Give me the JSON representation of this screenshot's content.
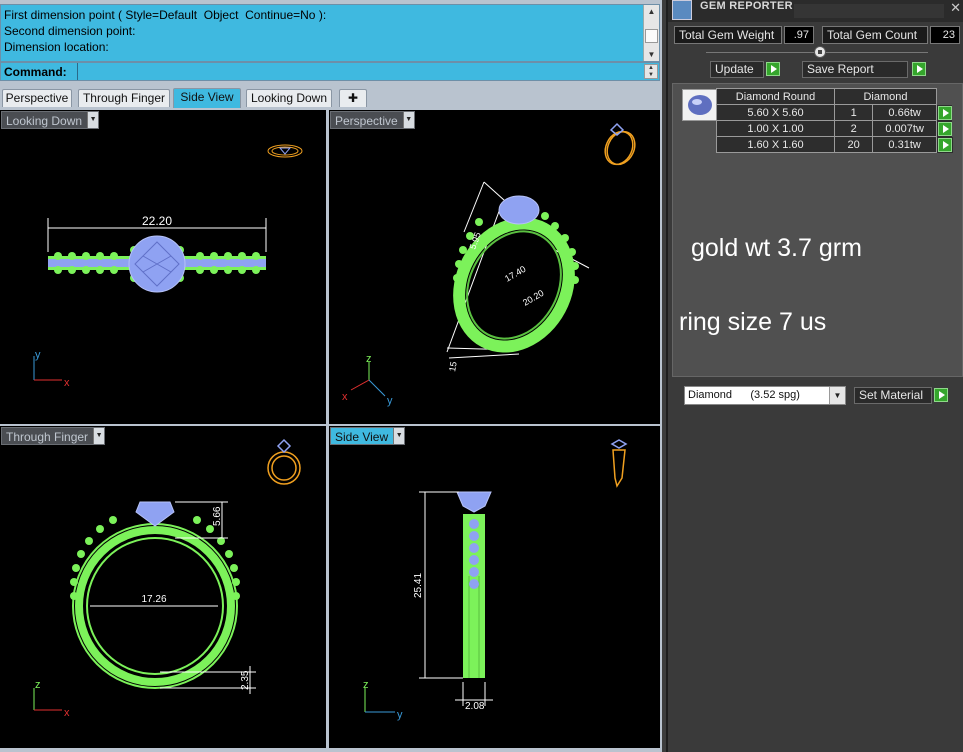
{
  "command": {
    "history": [
      "First dimension point ( Style=Default  Object  Continue=No ):",
      "Second dimension point:",
      "Dimension location:"
    ],
    "prompt_label": "Command:",
    "input_value": ""
  },
  "tabs": [
    {
      "label": "Perspective",
      "active": false
    },
    {
      "label": "Through Finger",
      "active": false
    },
    {
      "label": "Side View",
      "active": true
    },
    {
      "label": "Looking Down",
      "active": false
    }
  ],
  "new_tab_glyph": "✚",
  "viewports": {
    "looking_down": {
      "title": "Looking Down",
      "dimension": "22.20",
      "axis_y": "y",
      "axis_x": "x"
    },
    "perspective": {
      "title": "Perspective",
      "dim_a": "17.40",
      "dim_b": "20.20",
      "dim_c": "5.95",
      "dim_d": "15",
      "axis_z": "z",
      "axis_x": "x",
      "axis_y": "y"
    },
    "through_finger": {
      "title": "Through Finger",
      "dim_height": "5.66",
      "dim_inner": "17.26",
      "dim_shank": "2.35",
      "axis_z": "z",
      "axis_x": "x"
    },
    "side_view": {
      "title": "Side View",
      "dim_height": "25.41",
      "dim_width": "2.08",
      "axis_z": "z",
      "axis_y": "y"
    }
  },
  "colors": {
    "command_bg": "#3fb9e0",
    "ring_metal": "#7cf25a",
    "gems": "#8fa2f2",
    "dimension": "#ffffff",
    "axis_x": "#e23030",
    "axis_y": "#3a9ad8",
    "preview_icon": "#f0a020"
  },
  "gem_reporter": {
    "title": "GEM REPORTER",
    "close_glyph": "✕",
    "total_weight_label": "Total Gem Weight",
    "total_weight_value": ".97",
    "total_count_label": "Total Gem Count",
    "total_count_value": "23",
    "update_label": "Update",
    "save_report_label": "Save Report",
    "table": {
      "header_shape": "Diamond Round",
      "header_material": "Diamond",
      "rows": [
        {
          "size": "5.60 X 5.60",
          "count": "1",
          "weight": "0.66tw"
        },
        {
          "size": "1.00 X 1.00",
          "count": "2",
          "weight": "0.007tw"
        },
        {
          "size": "1.60 X 1.60",
          "count": "20",
          "weight": "0.31tw"
        }
      ]
    },
    "note_gold": "gold wt 3.7 grm",
    "note_size": "ring size 7 us",
    "material_select_value": "Diamond      (3.52 spg)",
    "set_material_label": "Set Material"
  }
}
